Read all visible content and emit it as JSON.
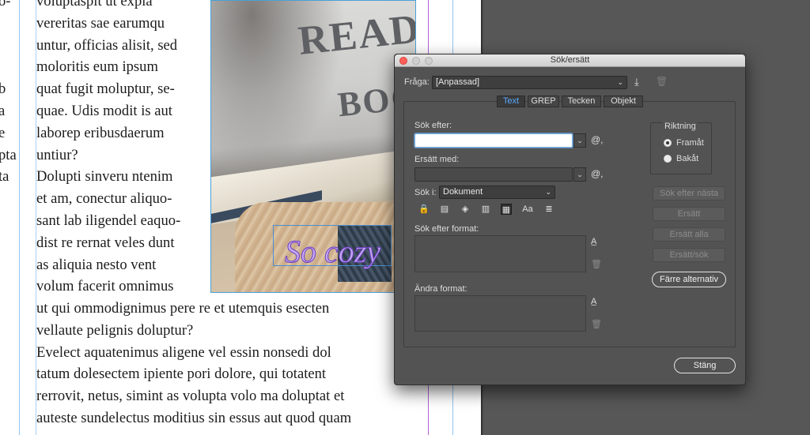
{
  "document": {
    "margin_lines": [
      "o-",
      "",
      "",
      "",
      "b",
      "a",
      "e",
      "pta",
      "ta",
      "",
      "",
      "",
      "",
      "",
      "",
      "",
      "",
      ""
    ],
    "column_lines": [
      "voluptaspit ut expla",
      "vereritas sae earumqu",
      "untur, officias alisit, sed",
      "moloritis eum ipsum",
      "quat fugit moluptur, se-",
      "quae. Udis modit is aut",
      "laborep eribusdaerum",
      "untiur?",
      "  Dolupti sinveru ntenim",
      "et am, conectur aliquo-",
      "sant lab iligendel eaquo-",
      "dist re rernat veles dunt",
      "as aliquia nesto vent",
      "volum facerit omnimus"
    ],
    "wide_lines": [
      "ut qui ommodignimus pere re et utemquis esecten",
      "vellaute pelignis doluptur?",
      "  Evelect aquatenimus aligene vel essin nonsedi dol",
      "tatum dolesectem ipiente pori dolore, qui totatent",
      "rerrovit, netus, simint as volupta volo ma doluptat et",
      "auteste sundelectus moditius sin essus aut quod quam"
    ],
    "pillow_text_1": "READ",
    "pillow_text_2": "BOO",
    "overlay_text": "So cozy"
  },
  "dialog": {
    "title": "Sök/ersätt",
    "query_label": "Fråga:",
    "query_value": "[Anpassad]",
    "save_query_icon": "download-icon",
    "delete_query_icon": "trash-icon",
    "tabs": [
      {
        "label": "Text",
        "active": true
      },
      {
        "label": "GREP",
        "active": false
      },
      {
        "label": "Tecken",
        "active": false
      },
      {
        "label": "Objekt",
        "active": false
      }
    ],
    "find_label": "Sök efter:",
    "find_value": "",
    "replace_label": "Ersätt med:",
    "replace_value": "",
    "search_in_label": "Sök i:",
    "search_in_value": "Dokument",
    "option_icons": [
      "locked-layers-icon",
      "locked-stories-icon",
      "hidden-layers-icon",
      "master-pages-icon",
      "footnotes-icon",
      "case-sensitive-icon",
      "whole-word-icon"
    ],
    "option_glyphs": [
      "🔒",
      "▤",
      "◈",
      "▥",
      "▦",
      "Aa",
      "≣"
    ],
    "find_format_label": "Sök efter format:",
    "change_format_label": "Ändra format:",
    "direction_label": "Riktning",
    "forward_label": "Framåt",
    "backward_label": "Bakåt",
    "direction_value": "Framåt",
    "buttons": {
      "find_next": "Sök efter nästa",
      "replace": "Ersätt",
      "replace_all": "Ersätt alla",
      "replace_find": "Ersätt/sök",
      "fewer_options": "Färre alternativ",
      "close": "Stäng"
    },
    "colors": {
      "active_tab": "#59a9ff",
      "close_dot": "#fe5f57",
      "minimize_dot": "#d0d0d0",
      "zoom_dot": "#d0d0d0"
    }
  }
}
